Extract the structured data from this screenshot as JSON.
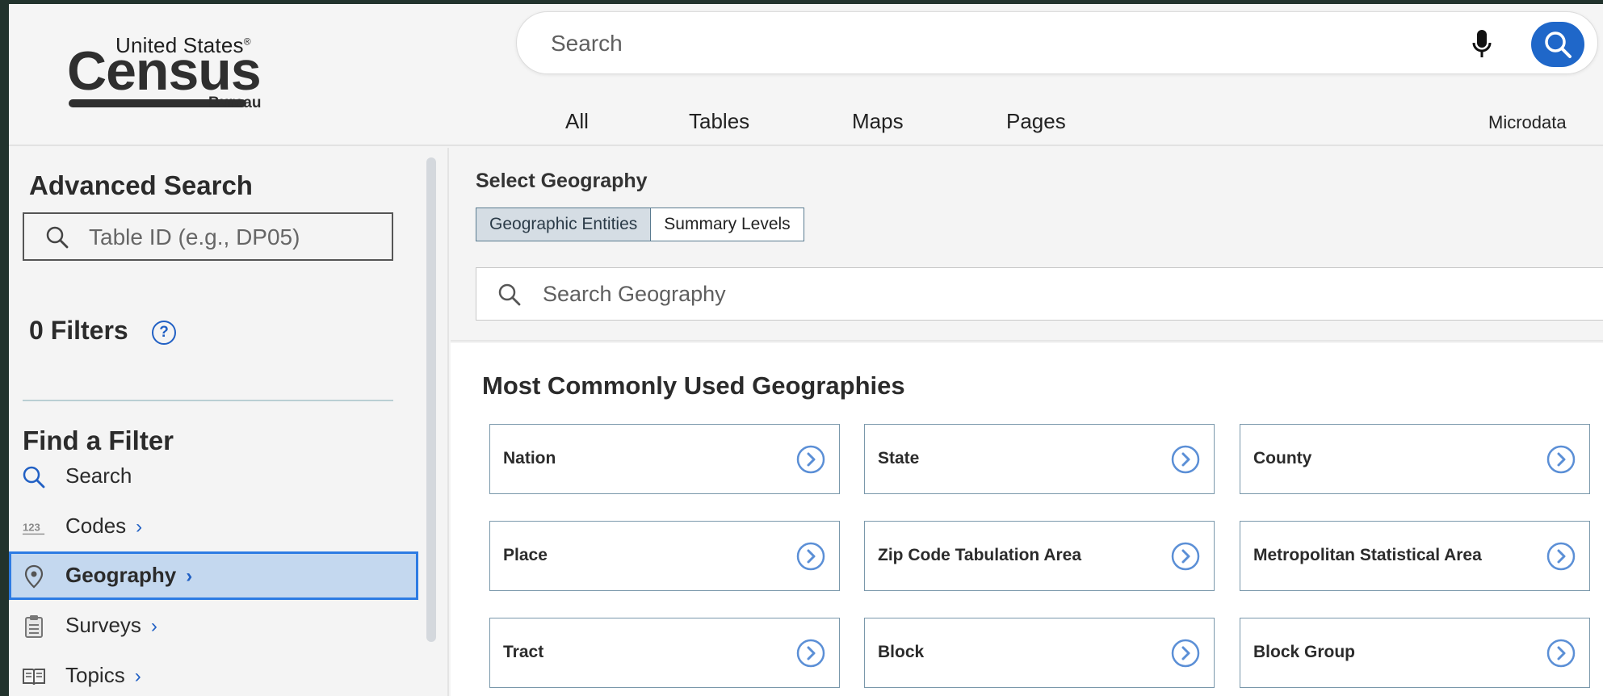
{
  "logo": {
    "line1": "United States",
    "registered": "®",
    "line2": "Census",
    "line3": "Bureau"
  },
  "search": {
    "placeholder": "Search"
  },
  "tabs": [
    {
      "label": "All"
    },
    {
      "label": "Tables"
    },
    {
      "label": "Maps"
    },
    {
      "label": "Pages"
    },
    {
      "label": "Microdata"
    }
  ],
  "sidebar": {
    "advanced_title": "Advanced Search",
    "table_id_placeholder": "Table ID (e.g., DP05)",
    "filters_label": "0 Filters",
    "help_glyph": "?",
    "find_title": "Find a Filter",
    "items": [
      {
        "label": "Search",
        "icon": "search-icon",
        "chevron": ""
      },
      {
        "label": "Codes",
        "icon": "codes-123-icon",
        "chevron": "›"
      },
      {
        "label": "Geography",
        "icon": "map-pin-icon",
        "chevron": "›"
      },
      {
        "label": "Surveys",
        "icon": "clipboard-icon",
        "chevron": "›"
      },
      {
        "label": "Topics",
        "icon": "book-icon",
        "chevron": "›"
      }
    ],
    "active_item": "Geography"
  },
  "main": {
    "select_title": "Select Geography",
    "segments": [
      {
        "label": "Geographic Entities",
        "selected": true
      },
      {
        "label": "Summary Levels",
        "selected": false
      }
    ],
    "geo_search_placeholder": "Search Geography",
    "most_title": "Most Commonly Used Geographies",
    "geographies": [
      {
        "label": "Nation"
      },
      {
        "label": "State"
      },
      {
        "label": "County"
      },
      {
        "label": "Place"
      },
      {
        "label": "Zip Code Tabulation Area"
      },
      {
        "label": "Metropolitan Statistical Area"
      },
      {
        "label": "Tract"
      },
      {
        "label": "Block"
      },
      {
        "label": "Block Group"
      }
    ]
  },
  "colors": {
    "accent": "#1f67c9",
    "active_bg": "#c4d8ef",
    "active_border": "#2d7be3",
    "card_border": "#7a98ab"
  }
}
